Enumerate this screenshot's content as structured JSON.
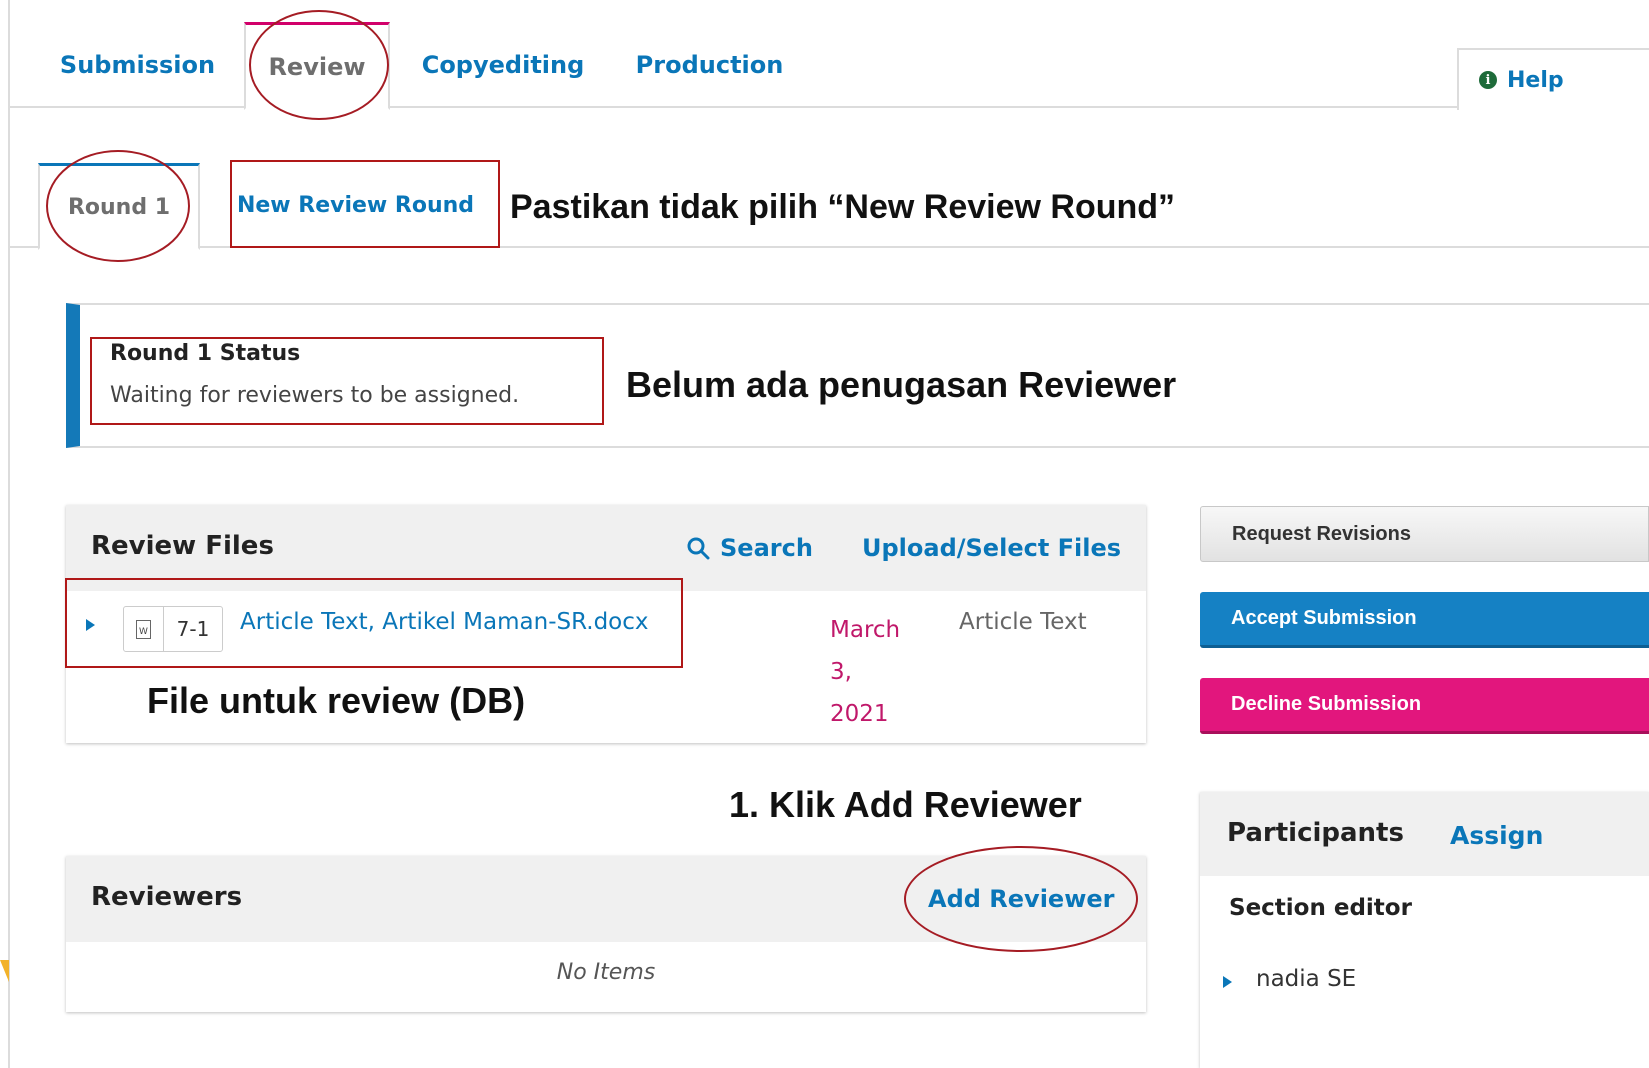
{
  "stage_tabs": [
    {
      "label": "Submission"
    },
    {
      "label": "Review"
    },
    {
      "label": "Copyediting"
    },
    {
      "label": "Production"
    }
  ],
  "help_label": "Help",
  "round_tabs": [
    {
      "label": "Round 1"
    },
    {
      "label": "New Review Round"
    }
  ],
  "status": {
    "title": "Round 1 Status",
    "text": "Waiting for reviewers to be assigned."
  },
  "review_files": {
    "title": "Review Files",
    "search_label": "Search",
    "upload_label": "Upload/Select Files",
    "file": {
      "id": "7-1",
      "name": "Article Text, Artikel Maman-SR.docx",
      "date_line1": "March",
      "date_line2": "3,",
      "date_line3": "2021",
      "type": "Article Text"
    }
  },
  "decisions": {
    "request_revisions": "Request Revisions",
    "accept": "Accept Submission",
    "decline": "Decline Submission"
  },
  "reviewers": {
    "title": "Reviewers",
    "add_label": "Add Reviewer",
    "empty": "No Items"
  },
  "participants": {
    "title": "Participants",
    "assign_label": "Assign",
    "section_editor_label": "Section editor",
    "members": [
      "nadia SE"
    ]
  },
  "annotations": {
    "new_round_note": "Pastikan tidak pilih “New Review Round”",
    "status_note": "Belum ada penugasan Reviewer",
    "file_note": "File untuk review (DB)",
    "step1_note": "1. Klik Add Reviewer"
  },
  "colors": {
    "link": "#0a76b8",
    "accept": "#1581c4",
    "decline": "#e2167d",
    "annotation": "#b01818"
  }
}
